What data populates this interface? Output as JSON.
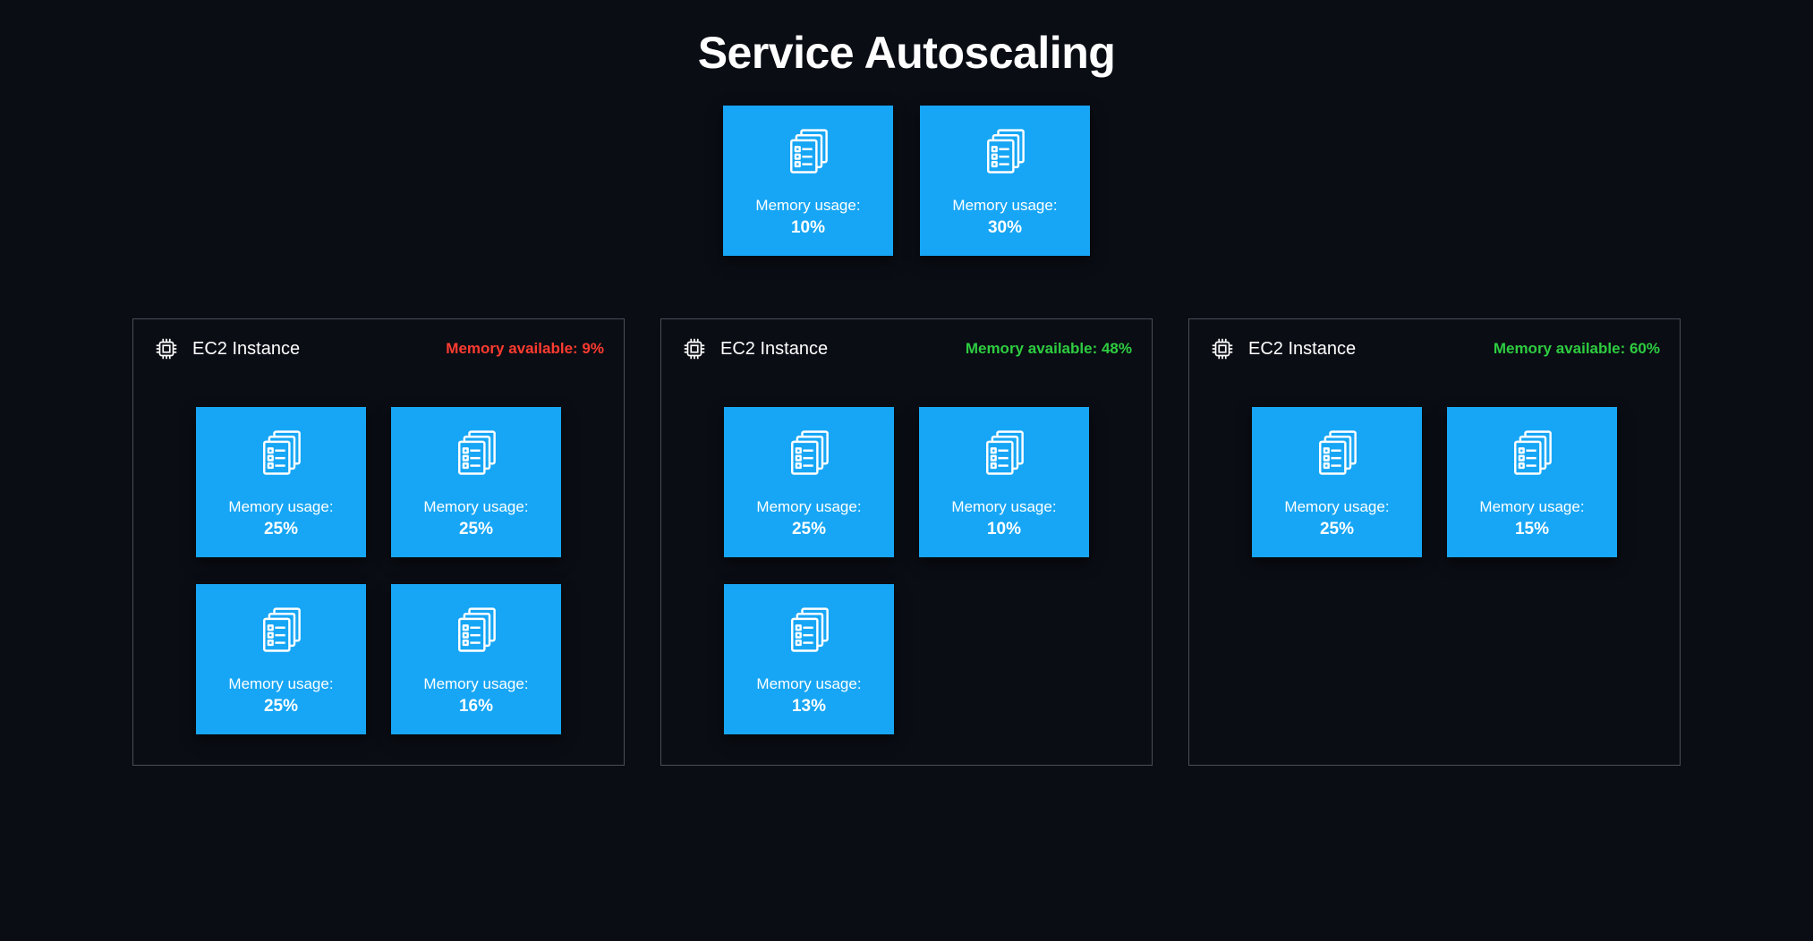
{
  "title": "Service Autoscaling",
  "task_label": "Memory usage:",
  "mem_avail_label": "Memory available:",
  "top_tasks": [
    {
      "usage": "10%"
    },
    {
      "usage": "30%"
    }
  ],
  "instances": [
    {
      "name": "EC2 Instance",
      "mem_available": "9%",
      "status": "red",
      "tasks": [
        {
          "usage": "25%"
        },
        {
          "usage": "25%"
        },
        {
          "usage": "25%"
        },
        {
          "usage": "16%"
        }
      ]
    },
    {
      "name": "EC2 Instance",
      "mem_available": "48%",
      "status": "green",
      "tasks": [
        {
          "usage": "25%"
        },
        {
          "usage": "10%"
        },
        {
          "usage": "13%"
        }
      ]
    },
    {
      "name": "EC2 Instance",
      "mem_available": "60%",
      "status": "green",
      "tasks": [
        {
          "usage": "25%"
        },
        {
          "usage": "15%"
        }
      ]
    }
  ]
}
